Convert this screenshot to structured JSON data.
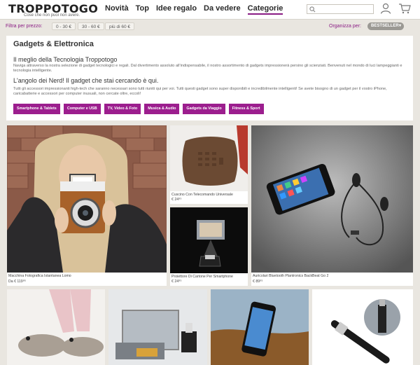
{
  "header": {
    "logo": "TROPPOTOGO",
    "tagline": "Cose che non puoi non avere.",
    "nav": [
      "Novità",
      "Top",
      "Idee regalo",
      "Da vedere",
      "Categorie"
    ],
    "active_nav": "Categorie",
    "search": {
      "value": "",
      "placeholder": ""
    }
  },
  "filters": {
    "label": "Filtra per prezzo:",
    "prices": [
      "0 - 30 €",
      "30 - 60 €",
      "più di 60 €"
    ],
    "sort_label": "Organizza per:",
    "sort_value": "BESTSELLER"
  },
  "intro": {
    "title": "Gadgets & Elettronica",
    "heading1": "Il meglio della Tecnologia Troppotogo",
    "text1": "Naviga attraverso la nostra selezione di gadget tecnologici e regali. Dal divertimento assoluto all'indispensabile, il nostro assortimento di gadgets impressionerà persino gli scienziati. Benvenuti nel mondo di luci lampeggianti e tecnologia intelligente.",
    "heading2": "L'angolo dei Nerd! Il gadget che stai cercando è qui.",
    "text2": "Tutti gli accessori impressionanti high-tech che saranno necessari sono tutti riuniti qui per voi. Tutti questi gadget sono super disponibili e incredibilmente intelligenti! Se avete bisogno di un gadget per il vostro iPhone, caricabatterie e accessori per computer inusuali, non cercate oltre, eccoli!",
    "categories": [
      "Smartphone & Tablets",
      "Computer e USB",
      "TV, Video & Foto",
      "Musica & Audio",
      "Gadgets da Viaggio",
      "Fitness & Sport"
    ]
  },
  "products": [
    {
      "name": "Macchina Fotografica Istantanea Lomo",
      "price": "Da € 119⁹⁵"
    },
    {
      "name": "Cuscino Con Telecomando Universale",
      "price": "€ 24⁹⁵"
    },
    {
      "name": "Proiettore Di Cartone Per Smartphone",
      "price": "€ 24⁹⁵"
    },
    {
      "name": "Auricolari Bluetooth Plantronics BackBeat Go 2",
      "price": "€ 89⁹⁵"
    }
  ],
  "colors": {
    "accent": "#8a1c84",
    "button": "#9c1e8e",
    "background": "#e9e6e0"
  }
}
